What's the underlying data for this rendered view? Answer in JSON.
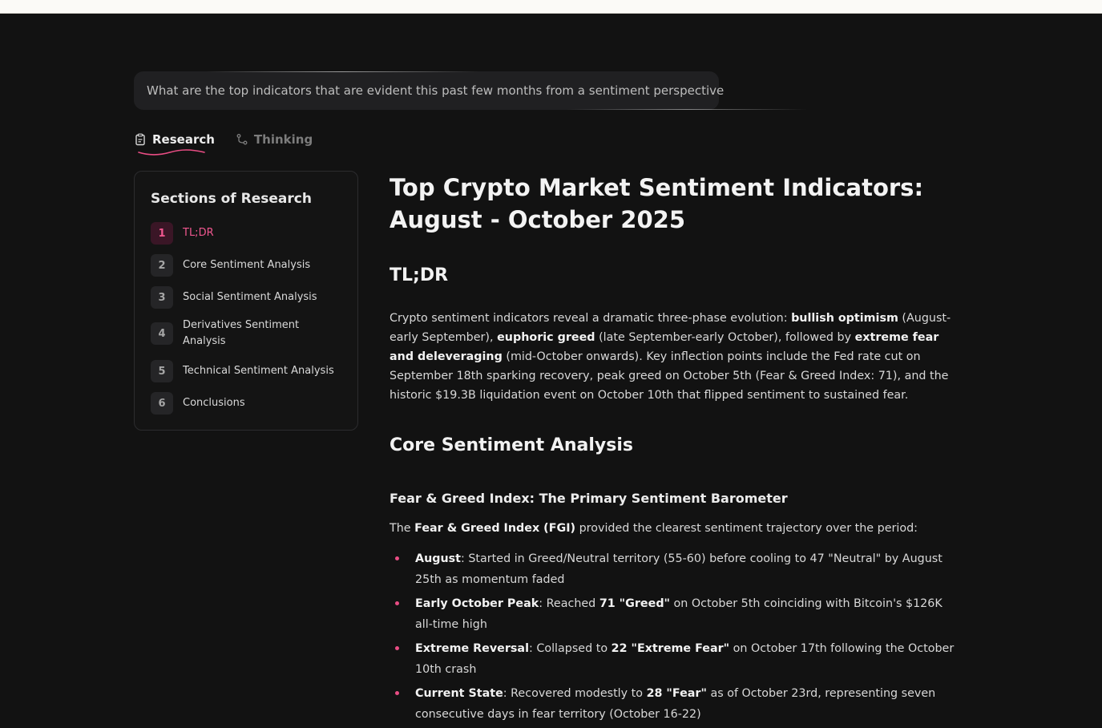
{
  "query": {
    "text": "What are the top indicators that are evident this past few months from a sentiment perspective"
  },
  "tabs": [
    {
      "label": "Research",
      "icon": "clipboard-icon",
      "active": true
    },
    {
      "label": "Thinking",
      "icon": "branch-icon",
      "active": false
    }
  ],
  "sidebar": {
    "title": "Sections of Research",
    "items": [
      {
        "num": "1",
        "label": "TL;DR",
        "active": true
      },
      {
        "num": "2",
        "label": "Core Sentiment Analysis"
      },
      {
        "num": "3",
        "label": "Social Sentiment Analysis"
      },
      {
        "num": "4",
        "label": "Derivatives Sentiment Analysis"
      },
      {
        "num": "5",
        "label": "Technical Sentiment Analysis"
      },
      {
        "num": "6",
        "label": "Conclusions"
      }
    ]
  },
  "report": {
    "title_line1": "Top Crypto Market Sentiment Indicators:",
    "title_line2": "August - October 2025",
    "tldr_heading": "TL;DR",
    "tldr": {
      "t1": "Crypto sentiment indicators reveal a dramatic three-phase evolution: ",
      "b1": "bullish optimism",
      "t2": " (August-early September), ",
      "b2": "euphoric greed",
      "t3": " (late September-early October), followed by ",
      "b3": "extreme fear and deleveraging",
      "t4": " (mid-October onwards). Key inflection points include the Fed rate cut on September 18th sparking recovery, peak greed on October 5th (Fear & Greed Index: 71), and the historic $19.3B liquidation event on October 10th that flipped sentiment to sustained fear."
    },
    "core_heading": "Core Sentiment Analysis",
    "fgi_heading": "Fear & Greed Index: The Primary Sentiment Barometer",
    "fgi_intro": {
      "t1": "The ",
      "b1": "Fear & Greed Index (FGI)",
      "t2": " provided the clearest sentiment trajectory over the period:"
    },
    "bullets": [
      {
        "b1": "August",
        "t1": ": Started in Greed/Neutral territory (55-60) before cooling to 47 \"Neutral\" by August 25th as momentum faded",
        "b2": "",
        "t2": ""
      },
      {
        "b1": "Early October Peak",
        "t1": ": Reached ",
        "b2": "71 \"Greed\"",
        "t2": " on October 5th coinciding with Bitcoin's $126K all-time high"
      },
      {
        "b1": "Extreme Reversal",
        "t1": ": Collapsed to ",
        "b2": "22 \"Extreme Fear\"",
        "t2": " on October 17th following the October 10th crash"
      },
      {
        "b1": "Current State",
        "t1": ": Recovered modestly to ",
        "b2": "28 \"Fear\"",
        "t2": " as of October 23rd, representing seven consecutive days in fear territory (October 16-22)"
      }
    ]
  },
  "colors": {
    "accent": "#f0578f",
    "background": "#121212",
    "panel": "#202022"
  }
}
